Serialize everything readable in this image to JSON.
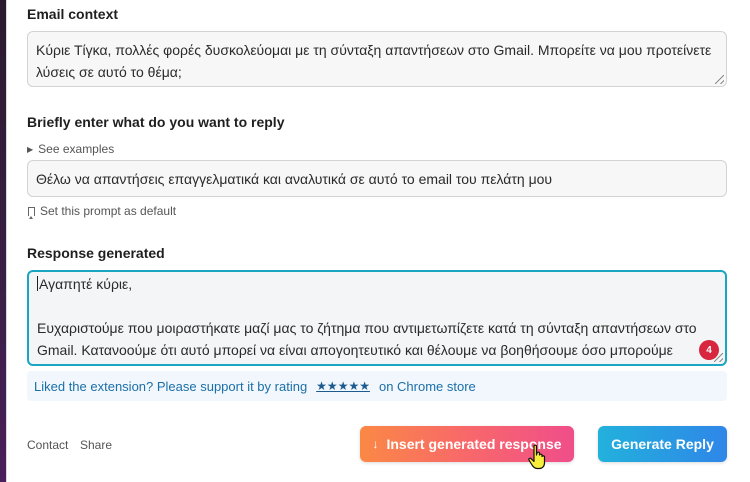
{
  "email_context": {
    "label": "Email context",
    "value": "Κύριε Τίγκα, πολλές φορές δυσκολεύομαι με τη σύνταξη απαντήσεων στο Gmail. Μπορείτε να μου προτείνετε λύσεις σε αυτό το θέμα;"
  },
  "reply_intent": {
    "label": "Briefly enter what do you want to reply",
    "see_examples": "See examples",
    "value": "Θέλω να απαντήσεις επαγγελματικά και αναλυτικά σε αυτό το email του πελάτη μου",
    "set_default": "Set this prompt as default"
  },
  "response": {
    "label": "Response generated",
    "greeting": "Αγαπητέ κύριε,",
    "body": "Ευχαριστούμε που μοιραστήκατε μαζί μας το ζήτημα που αντιμετωπίζετε κατά τη σύνταξη απαντήσεων στο Gmail. Κατανοούμε ότι αυτό μπορεί να είναι απογοητευτικό και θέλουμε να βοηθήσουμε όσο μπορούμε",
    "badge_count": "4"
  },
  "rating": {
    "prefix": "Liked the extension? Please support it by rating",
    "stars": "★★★★★",
    "suffix": "on Chrome store"
  },
  "footer": {
    "contact": "Contact",
    "share": "Share",
    "insert_button": "Insert generated response",
    "generate_button": "Generate Reply"
  },
  "colors": {
    "accent_teal": "#1aa6c3",
    "insert_gradient_start": "#fa8845",
    "insert_gradient_end": "#f04e8a",
    "generate_gradient_start": "#22b1dc",
    "generate_gradient_end": "#2f86e8",
    "badge": "#d7263d"
  },
  "icons": {
    "see_examples": "triangle-right-icon",
    "set_default": "bookmark-icon",
    "insert": "arrow-down-icon",
    "cursor": "hand-pointer-icon"
  }
}
